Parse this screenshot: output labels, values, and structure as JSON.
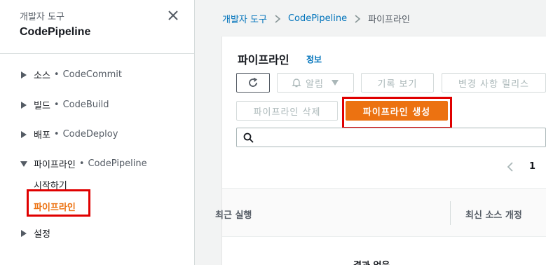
{
  "sidebar": {
    "section_label": "개발자 도구",
    "service_title": "CodePipeline",
    "items": [
      {
        "name": "소스",
        "sub": "CodeCommit"
      },
      {
        "name": "빌드",
        "sub": "CodeBuild"
      },
      {
        "name": "배포",
        "sub": "CodeDeploy"
      },
      {
        "name": "파이프라인",
        "sub": "CodePipeline"
      }
    ],
    "pipeline_children": [
      "시작하기",
      "파이프라인"
    ],
    "settings_label": "설정",
    "bullet": "•"
  },
  "breadcrumb": {
    "items": [
      "개발자 도구",
      "CodePipeline",
      "파이프라인"
    ]
  },
  "panel": {
    "title": "파이프라인",
    "info_link": "정보",
    "buttons": {
      "alarm": "알림",
      "history": "기록 보기",
      "release": "변경 사항 릴리스",
      "delete": "파이프라인 삭제",
      "create": "파이프라인 생성"
    },
    "search_placeholder": "",
    "page_number": "1",
    "columns": [
      "최근 실행",
      "최신 소스 개정"
    ],
    "empty_message": "결과 없음"
  },
  "colors": {
    "accent": "#ec7211",
    "link": "#0073bb",
    "highlight": "#e00000"
  },
  "icons": [
    "close-icon",
    "caret-right-icon",
    "caret-down-icon",
    "chevron-right-icon",
    "refresh-icon",
    "bell-icon",
    "dropdown-caret-icon",
    "search-icon",
    "pager-prev-icon"
  ]
}
